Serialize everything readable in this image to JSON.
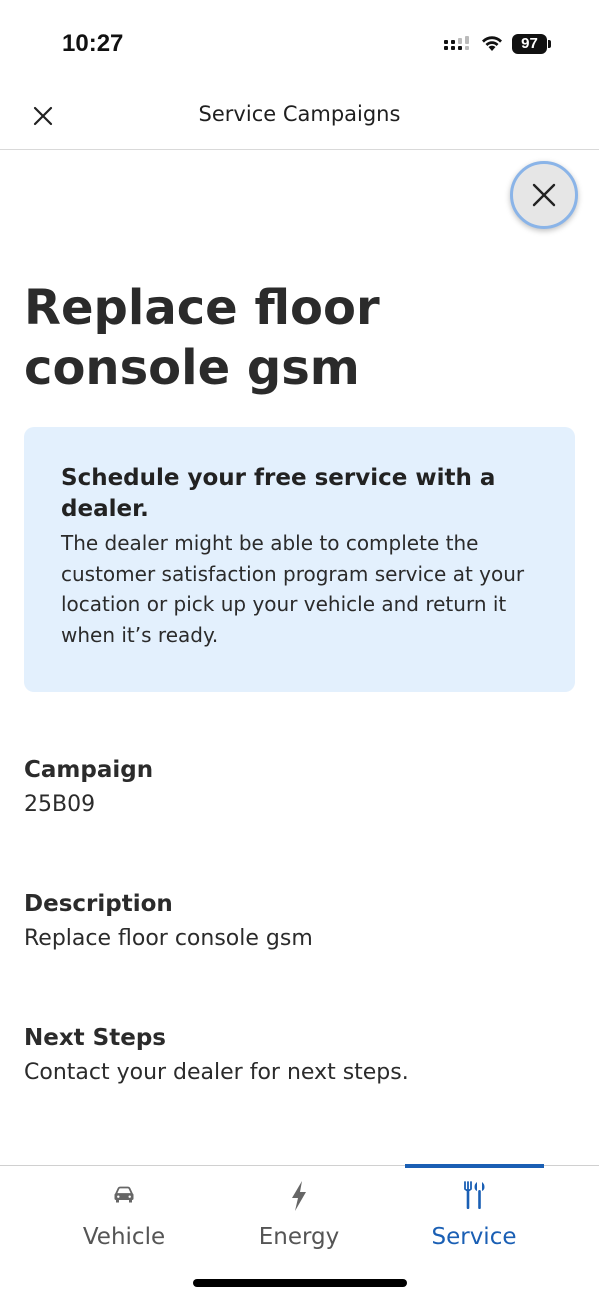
{
  "status_bar": {
    "time": "10:27",
    "battery": "97"
  },
  "header": {
    "title": "Service Campaigns",
    "close_icon": "close-icon"
  },
  "page": {
    "title": "Replace floor console gsm",
    "dismiss_icon": "close-icon"
  },
  "info_box": {
    "heading": "Schedule your free service with a dealer.",
    "body": "The dealer might be able to complete the customer satisfaction program service at your location or pick up your vehicle and return it when it’s ready.",
    "background_color": "#e3f0fd"
  },
  "details": [
    {
      "label": "Campaign",
      "value": "25B09"
    },
    {
      "label": "Description",
      "value": "Replace floor console gsm"
    },
    {
      "label": "Next Steps",
      "value": "Contact your dealer for next steps."
    }
  ],
  "tabs": [
    {
      "label": "Vehicle",
      "icon": "car-icon",
      "active": false
    },
    {
      "label": "Energy",
      "icon": "lightning-bolt-icon",
      "active": false
    },
    {
      "label": "Service",
      "icon": "tools-icon",
      "active": true
    }
  ],
  "colors": {
    "accent": "#1a5fb4",
    "text": "#2b2b2b"
  }
}
